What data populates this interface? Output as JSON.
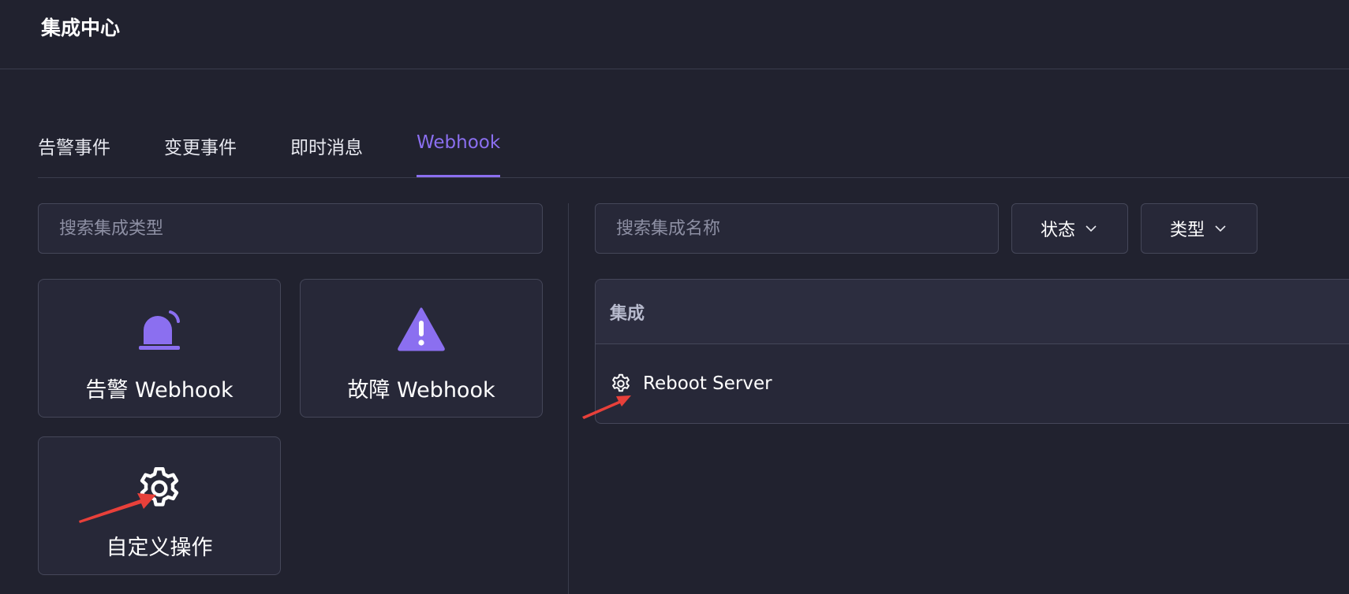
{
  "header": {
    "title": "集成中心"
  },
  "tabs": [
    {
      "label": "告警事件",
      "active": false
    },
    {
      "label": "变更事件",
      "active": false
    },
    {
      "label": "即时消息",
      "active": false
    },
    {
      "label": "Webhook",
      "active": true
    }
  ],
  "left_panel": {
    "search": {
      "placeholder": "搜索集成类型",
      "value": ""
    },
    "cards": [
      {
        "label": "告警 Webhook",
        "icon": "alarm-light-icon"
      },
      {
        "label": "故障 Webhook",
        "icon": "warning-triangle-icon"
      },
      {
        "label": "自定义操作",
        "icon": "gear-icon"
      }
    ]
  },
  "right_panel": {
    "search": {
      "placeholder": "搜索集成名称",
      "value": ""
    },
    "filters": [
      {
        "label": "状态",
        "icon": "chevron-down-icon"
      },
      {
        "label": "类型",
        "icon": "chevron-down-icon"
      }
    ],
    "table": {
      "header": "集成",
      "rows": [
        {
          "label": "Reboot Server",
          "icon": "gear-icon"
        }
      ]
    }
  },
  "colors": {
    "background": "#21222f",
    "accent": "#8b6ff0",
    "annotation_arrow": "#e8403a"
  }
}
